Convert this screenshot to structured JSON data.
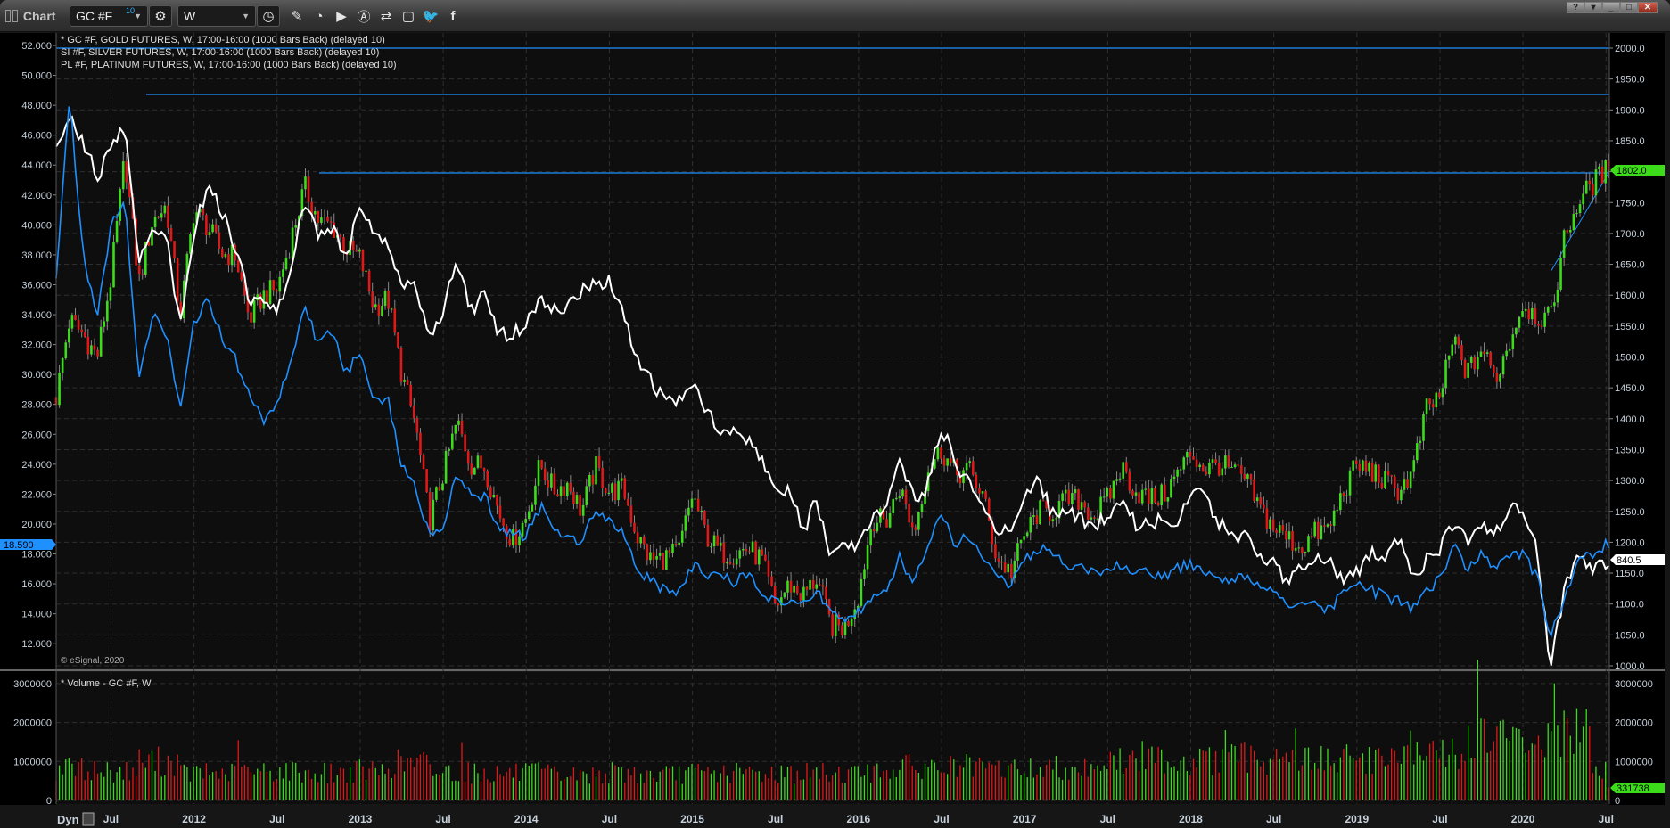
{
  "window": {
    "title": "Chart",
    "buttons": [
      "?",
      "▾",
      "_",
      "□",
      "✕"
    ]
  },
  "toolbar": {
    "symbol": "GC #F",
    "symbol_badge": "10",
    "interval": "W",
    "icons": [
      "link-gear-icon",
      "clock-icon",
      "pencil-icon",
      "study-icon",
      "play-icon",
      "alert-icon",
      "link-arrows-icon",
      "window-icon",
      "twitter-icon",
      "facebook-icon"
    ]
  },
  "legend": {
    "gold": "* GC #F, GOLD FUTURES, W, 17:00-16:00 (1000 Bars Back) (delayed 10)",
    "silver": "SI #F, SILVER FUTURES, W, 17:00-16:00 (1000 Bars Back) (delayed 10)",
    "platinum": "PL #F, PLATINUM FUTURES, W, 17:00-16:00 (1000 Bars Back) (delayed 10)",
    "volume": "* Volume - GC #F, W"
  },
  "copyright": "© eSignal, 2020",
  "bottom": {
    "dyn": "Dyn"
  },
  "price_tags": {
    "silver": "18.590",
    "gold": "1802.0",
    "platinum": "840.5",
    "volume": "331738"
  },
  "colors": {
    "up": "#3ddc1a",
    "down": "#e01818",
    "silver": "#1e90ff",
    "platinum": "#ffffff",
    "hline": "#1e90ff",
    "gold_tag": "#3ddc1a"
  },
  "chart_data": {
    "type": "candlestick",
    "start_year": 2011.17,
    "end_year": 2020.52,
    "x_ticks": [
      "Jul",
      "2012",
      "Jul",
      "2013",
      "Jul",
      "2014",
      "Jul",
      "2015",
      "Jul",
      "2016",
      "Jul",
      "2017",
      "Jul",
      "2018",
      "Jul",
      "2019",
      "Jul",
      "2020",
      "Jul"
    ],
    "right_axis": {
      "ylim": [
        1000,
        2000
      ],
      "ticks": [
        "2000.0",
        "1950.0",
        "1900.0",
        "1850.0",
        "1800.0",
        "1750.0",
        "1700.0",
        "1650.0",
        "1600.0",
        "1550.0",
        "1500.0",
        "1450.0",
        "1400.0",
        "1350.0",
        "1300.0",
        "1250.0",
        "1200.0",
        "1150.0",
        "1100.0",
        "1050.0",
        "1000.0"
      ]
    },
    "left_axis": {
      "ylim": [
        12,
        52
      ],
      "ticks": [
        "52.000",
        "50.000",
        "48.000",
        "46.000",
        "44.000",
        "42.000",
        "40.000",
        "38.000",
        "36.000",
        "34.000",
        "32.000",
        "30.000",
        "28.000",
        "26.000",
        "24.000",
        "22.000",
        "20.000",
        "18.000",
        "16.000",
        "14.000",
        "12.000"
      ]
    },
    "volume_axis": {
      "ylim": [
        0,
        3000000
      ],
      "ticks": [
        "3000000",
        "2000000",
        "1000000",
        "0"
      ]
    },
    "horizontal_lines": [
      2000,
      1925,
      1798
    ],
    "monthly_start": "2011-03",
    "gold_monthly": [
      1430,
      1560,
      1536,
      1500,
      1628,
      1825,
      1620,
      1720,
      1745,
      1565,
      1740,
      1710,
      1668,
      1664,
      1560,
      1600,
      1610,
      1690,
      1775,
      1720,
      1712,
      1675,
      1660,
      1580,
      1595,
      1472,
      1390,
      1235,
      1312,
      1395,
      1326,
      1323,
      1250,
      1202,
      1240,
      1326,
      1284,
      1296,
      1250,
      1322,
      1282,
      1287,
      1210,
      1171,
      1175,
      1184,
      1278,
      1212,
      1183,
      1182,
      1190,
      1172,
      1095,
      1132,
      1114,
      1142,
      1065,
      1061,
      1116,
      1238,
      1234,
      1290,
      1215,
      1320,
      1350,
      1310,
      1317,
      1275,
      1173,
      1152,
      1211,
      1250,
      1249,
      1268,
      1268,
      1242,
      1270,
      1322,
      1283,
      1270,
      1275,
      1309,
      1345,
      1318,
      1327,
      1315,
      1300,
      1253,
      1224,
      1206,
      1192,
      1215,
      1222,
      1282,
      1325,
      1316,
      1298,
      1285,
      1311,
      1413,
      1437,
      1529,
      1472,
      1514,
      1464,
      1523,
      1587,
      1566,
      1560,
      1694,
      1751,
      1780,
      1802
    ],
    "silver_monthly": [
      36,
      48.6,
      38,
      34,
      40,
      41.5,
      30,
      34,
      32.5,
      28,
      33.5,
      35,
      32.5,
      31,
      28.5,
      27,
      28,
      31,
      34.5,
      32,
      33,
      30,
      31.5,
      28.5,
      28.3,
      24,
      22.3,
      19.5,
      19.7,
      23.5,
      21.7,
      21.9,
      19.6,
      19.4,
      19.2,
      21.2,
      19.7,
      19,
      19,
      21,
      20.4,
      19.5,
      17,
      16.2,
      15.5,
      15.6,
      17.2,
      16.6,
      16.6,
      16,
      16.8,
      15.6,
      14.7,
      14.6,
      14.5,
      15.5,
      14.1,
      13.8,
      14.1,
      15,
      15.4,
      17.8,
      16,
      18.7,
      20.4,
      18.7,
      19.2,
      17.7,
      16.5,
      16,
      17.5,
      18.4,
      18.2,
      17.2,
      17.3,
      16.6,
      16.7,
      17.5,
      16.6,
      16.7,
      16.5,
      17,
      17.3,
      16.5,
      16.3,
      16.3,
      16.4,
      16.1,
      15.5,
      14.5,
      14.7,
      14.7,
      14.1,
      15.4,
      16,
      15.6,
      15.1,
      14.9,
      14.4,
      15.3,
      16.4,
      18.4,
      17,
      18,
      17,
      17.9,
      18,
      16.5,
      12.5,
      15,
      18,
      17.6,
      18.59
    ],
    "platinum_hidden_ylim": [
      600,
      2014
    ],
    "platinum_monthly": [
      1770,
      1860,
      1800,
      1720,
      1780,
      1840,
      1520,
      1600,
      1580,
      1380,
      1600,
      1700,
      1640,
      1560,
      1440,
      1450,
      1400,
      1520,
      1660,
      1580,
      1610,
      1530,
      1670,
      1580,
      1570,
      1480,
      1470,
      1340,
      1420,
      1520,
      1410,
      1450,
      1360,
      1360,
      1380,
      1450,
      1410,
      1420,
      1460,
      1480,
      1480,
      1420,
      1300,
      1250,
      1210,
      1200,
      1240,
      1190,
      1130,
      1130,
      1110,
      1080,
      990,
      1000,
      910,
      980,
      840,
      880,
      870,
      940,
      970,
      1070,
      980,
      1010,
      1150,
      1060,
      1020,
      960,
      910,
      900,
      990,
      1020,
      950,
      950,
      940,
      920,
      940,
      990,
      920,
      920,
      940,
      930,
      1000,
      990,
      930,
      900,
      900,
      850,
      830,
      790,
      820,
      840,
      840,
      790,
      810,
      860,
      850,
      890,
      800,
      840,
      870,
      930,
      890,
      930,
      900,
      970,
      960,
      860,
      600,
      770,
      860,
      820,
      840.5
    ],
    "volume_quarterly_millions": [
      0.8,
      0.75,
      1.0,
      0.7,
      0.7,
      0.75,
      0.7,
      0.75,
      0.95,
      0.75,
      0.7,
      0.7,
      0.65,
      0.7,
      0.65,
      0.7,
      0.7,
      0.7,
      0.7,
      0.7,
      0.85,
      0.85,
      0.8,
      0.8,
      0.85,
      1.0,
      1.1,
      1.0,
      1.1,
      1.1,
      1.05,
      1.05,
      1.1,
      1.2,
      1.6,
      1.5,
      1.7,
      0.9,
      0.85
    ]
  }
}
